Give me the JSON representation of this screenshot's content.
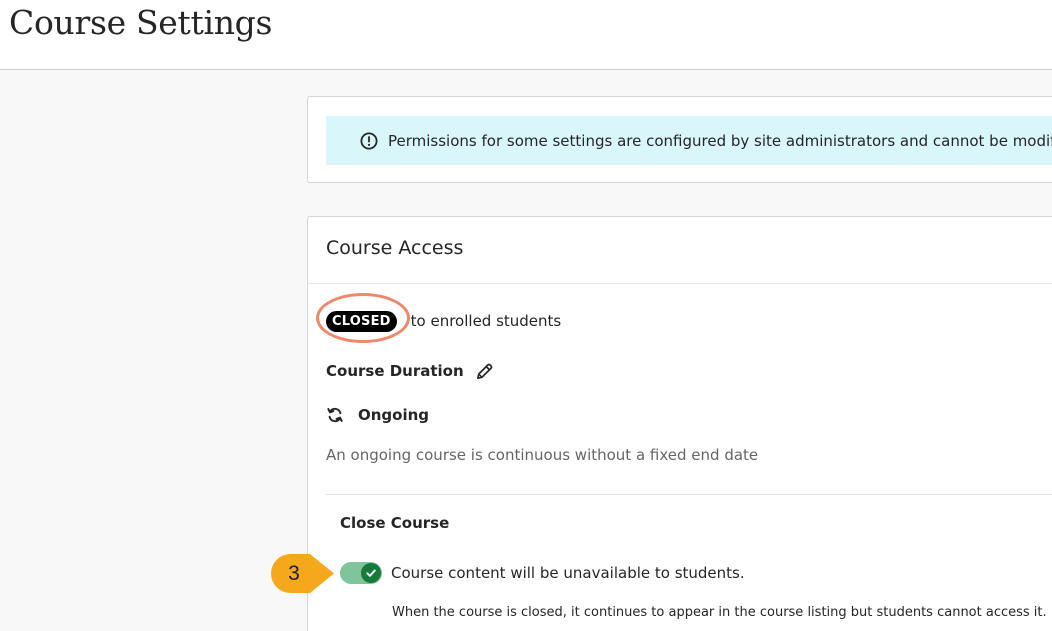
{
  "header": {
    "title": "Course Settings"
  },
  "notice": {
    "icon": "info-circle-icon",
    "text": "Permissions for some settings are configured by site administrators and cannot be modified."
  },
  "course_access": {
    "title": "Course Access",
    "status_badge": "CLOSED",
    "status_text": "to enrolled students",
    "duration_label": "Course Duration",
    "duration_edit_icon": "pencil-icon",
    "ongoing_icon": "refresh-icon",
    "ongoing_label": "Ongoing",
    "ongoing_description": "An ongoing course is continuous without a fixed end date",
    "close_course": {
      "title": "Close Course",
      "toggle_on": true,
      "toggle_text": "Course content will be unavailable to students.",
      "help_text": "When the course is closed, it continues to appear in the course listing but students cannot access it."
    }
  },
  "callout": {
    "number": "3",
    "color": "#f5a81c"
  },
  "colors": {
    "highlight_ring": "#f0876a",
    "notice_bg": "#d9f6fb",
    "toggle_track": "#7fc49a",
    "toggle_knob": "#167a3b"
  }
}
